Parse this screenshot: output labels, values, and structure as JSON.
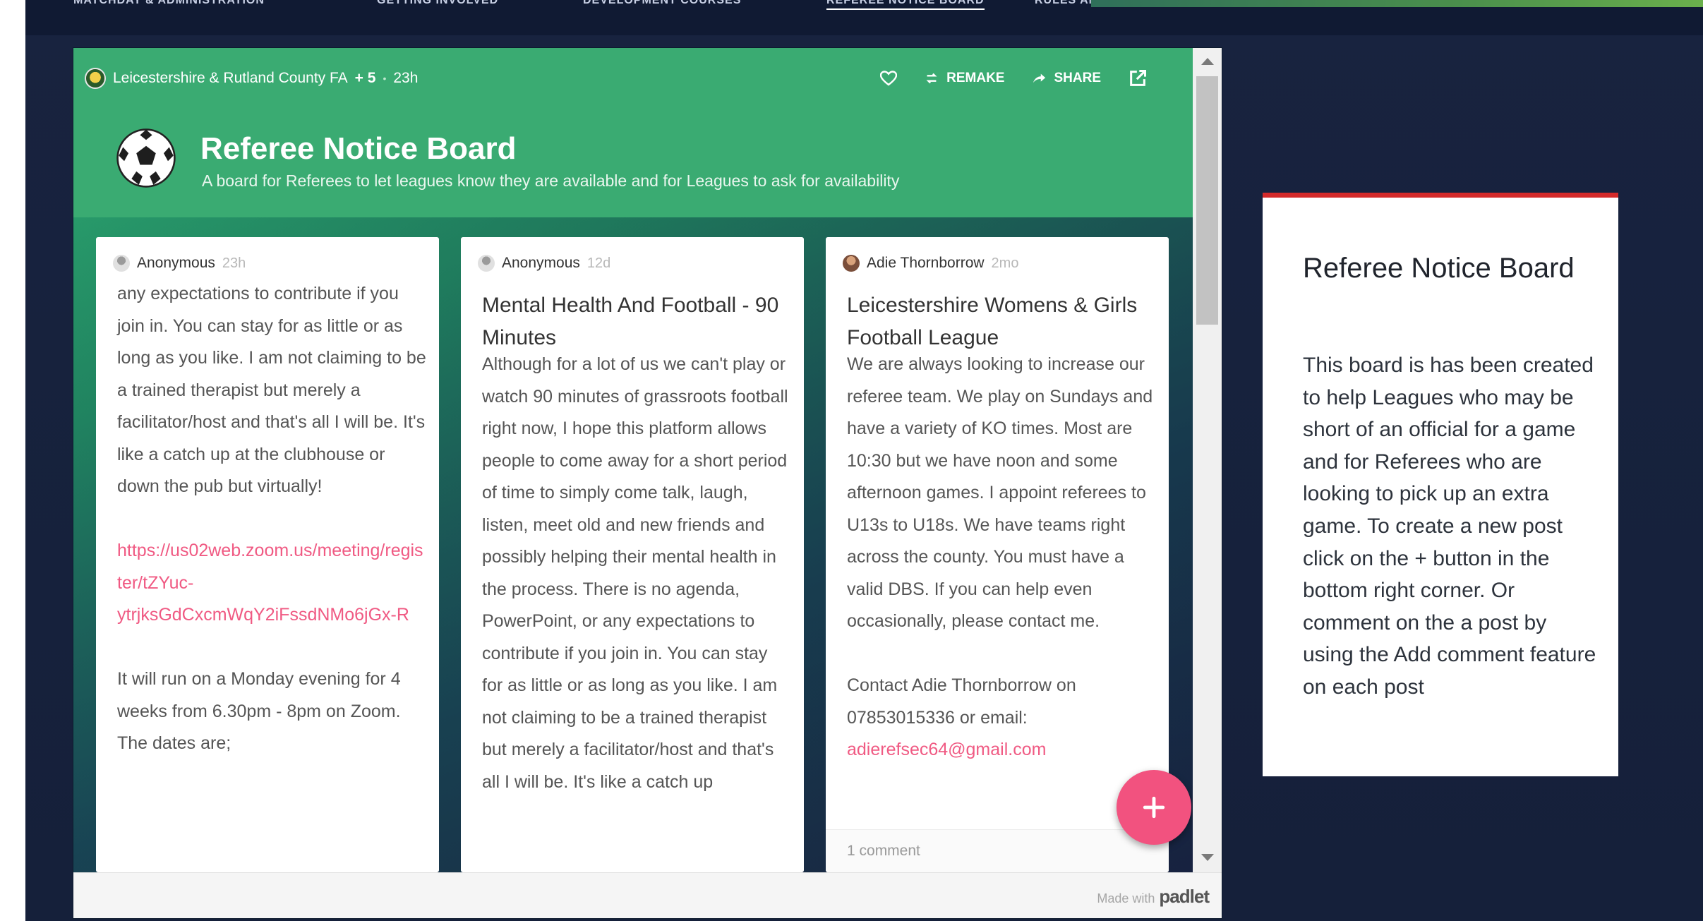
{
  "nav": {
    "items": [
      "MATCHDAY & ADMINISTRATION",
      "GETTING INVOLVED",
      "DEVELOPMENT COURSES",
      "REFEREE NOTICE BOARD",
      "RULES AND REGULATIONS"
    ],
    "active_index": 3
  },
  "padlet": {
    "owner": "Leicestershire & Rutland County FA",
    "contributors": "+ 5",
    "age": "23h",
    "actions": {
      "remake": "REMAKE",
      "share": "SHARE"
    },
    "title": "Referee Notice Board",
    "description": "A board for Referees to let leagues know they are available and for Leagues to ask for availability",
    "posts": [
      {
        "author": "Anonymous",
        "age": "23h",
        "subject": "",
        "body_before_link": "any expectations to contribute if you join in. You can stay for as little or as long as you like. I am not claiming to be a trained therapist but merely a facilitator/host and that's all I will be. It's like a catch up at the clubhouse or down the pub but virtually!",
        "link": "https://us02web.zoom.us/meeting/register/tZYuc-ytrjksGdCxcmWqY2iFssdNMo6jGx-R",
        "body_after_link": "It will run on a Monday evening for 4 weeks from 6.30pm - 8pm on Zoom. The dates are;",
        "comments": ""
      },
      {
        "author": "Anonymous",
        "age": "12d",
        "subject": "Mental Health And Football - 90 Minutes",
        "body_before_link": "Although for a lot of us we can't play or watch 90 minutes of grassroots football right now, I hope this platform allows people to come away for a short period of time to simply come talk, laugh, listen, meet old and new friends and possibly helping their mental health in the process. There is no agenda, PowerPoint, or any expectations to contribute if you join in. You can stay for as little or as long as you like. I am not claiming to be a trained therapist but merely a facilitator/host and that's all I will be. It's like a catch up",
        "link": "",
        "body_after_link": "",
        "comments": ""
      },
      {
        "author": "Adie Thornborrow",
        "age": "2mo",
        "subject": "Leicestershire Womens & Girls Football League",
        "body_before_link": "We are always looking to increase our referee team. We play on Sundays and have a variety of KO times. Most are 10:30 but we have noon and some afternoon games. I appoint referees to U13s to U18s. We have teams right across the county. You must have a valid DBS. If you can help even occasionally, please contact me.\n\nContact Adie Thornborrow on 07853015336 or email:",
        "link": "adierefsec64@gmail.com",
        "body_after_link": "",
        "comments": "1 comment"
      }
    ],
    "footer": {
      "made_with": "Made with",
      "logo": "padlet"
    }
  },
  "side_panel": {
    "title": "Referee Notice Board",
    "body": "This board is has been created to help Leagues who may be short of an official for a game and for Referees who are looking to pick up an extra game. To create a new post click on the + button in the bottom right corner. Or comment on the a post by using the Add comment feature on each post"
  },
  "colors": {
    "header_green": "#3aab72",
    "accent_pink": "#f2527f",
    "side_panel_top": "#d42a2a",
    "page_navy": "#18233f"
  }
}
